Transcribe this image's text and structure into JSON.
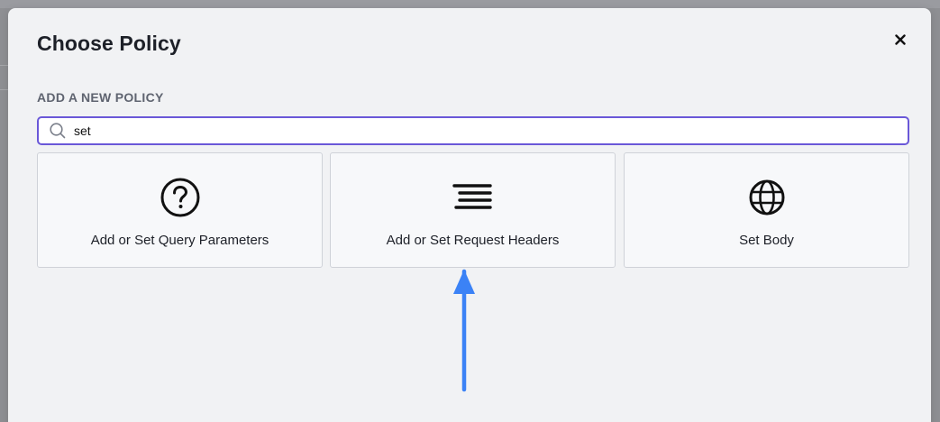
{
  "dialog": {
    "title": "Choose Policy",
    "close_icon": "close-icon",
    "section_label": "ADD A NEW POLICY",
    "search": {
      "value": "set",
      "placeholder": "",
      "icon": "search-icon"
    },
    "policies": [
      {
        "label": "Add or Set Query Parameters",
        "icon": "question-circle-icon"
      },
      {
        "label": "Add or Set Request Headers",
        "icon": "align-right-lines-icon"
      },
      {
        "label": "Set Body",
        "icon": "globe-icon"
      }
    ]
  },
  "annotation": {
    "icon": "arrow-up-icon",
    "color": "#3b82f6"
  },
  "colors": {
    "accent": "#6a58d8",
    "modal_bg": "#f1f2f4",
    "card_bg": "#f7f8fa",
    "backdrop": "#8e8f93"
  }
}
